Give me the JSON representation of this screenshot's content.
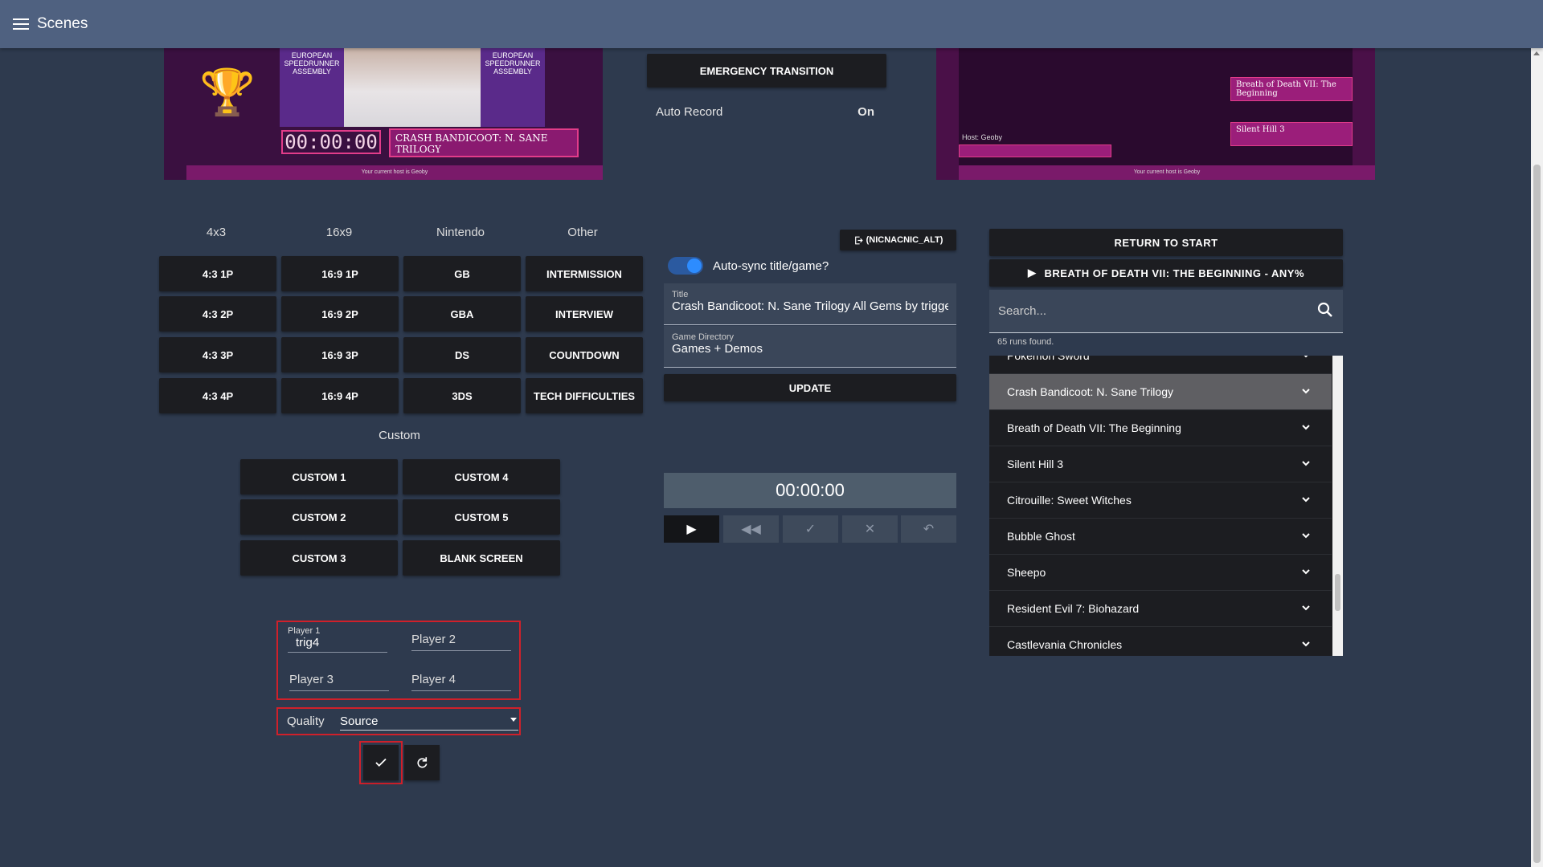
{
  "appbar": {
    "title": "Scenes"
  },
  "previews": {
    "left": {
      "banner1": "EUROPEAN SPEEDRUNNER ASSEMBLY",
      "banner2": "EUROPEAN SPEEDRUNNER ASSEMBLY",
      "timer": "00:00:00",
      "game": "CRASH BANDICOOT: N. SANE TRILOGY",
      "footer": "Your current host is Geoby"
    },
    "right": {
      "item1": "Breath of Death VII: The Beginning",
      "item2": "Silent Hill 3",
      "host": "Host: Geoby",
      "footer": "Your current host is Geoby"
    }
  },
  "center_top": {
    "emergency_label": "EMERGENCY TRANSITION",
    "auto_record_label": "Auto Record",
    "auto_record_value": "On"
  },
  "scenes": {
    "columns": [
      "4x3",
      "16x9",
      "Nintendo",
      "Other"
    ],
    "col_4x3": [
      "4:3 1P",
      "4:3 2P",
      "4:3 3P",
      "4:3 4P"
    ],
    "col_16x9": [
      "16:9 1P",
      "16:9 2P",
      "16:9 3P",
      "16:9 4P"
    ],
    "col_nintendo": [
      "GB",
      "GBA",
      "DS",
      "3DS"
    ],
    "col_other": [
      "INTERMISSION",
      "INTERVIEW",
      "COUNTDOWN",
      "TECH DIFFICULTIES"
    ],
    "custom_heading": "Custom",
    "custom": [
      "CUSTOM 1",
      "CUSTOM 2",
      "CUSTOM 3",
      "CUSTOM 4",
      "CUSTOM 5",
      "BLANK SCREEN"
    ]
  },
  "players": {
    "p1_label": "Player 1",
    "p1_value": "trig4",
    "p2_placeholder": "Player 2",
    "p3_placeholder": "Player 3",
    "p4_placeholder": "Player 4",
    "quality_label": "Quality",
    "quality_value": "Source"
  },
  "middle": {
    "account_chip": "(NICNACNIC_ALT)",
    "autosync_label": "Auto-sync title/game?",
    "autosync_on": true,
    "title_label": "Title",
    "title_value": "Crash Bandicoot: N. Sane Trilogy All Gems by trigge",
    "dir_label": "Game Directory",
    "dir_value": "Games + Demos",
    "update_label": "UPDATE",
    "timer": "00:00:00"
  },
  "right": {
    "return_label": "RETURN TO START",
    "current_run": "BREATH OF DEATH VII: THE BEGINNING - ANY%",
    "search_placeholder": "Search...",
    "runs_found": "65 runs found.",
    "runs": [
      "Pokemon Sword",
      "Crash Bandicoot: N. Sane Trilogy",
      "Breath of Death VII: The Beginning",
      "Silent Hill 3",
      "Citrouille: Sweet Witches",
      "Bubble Ghost",
      "Sheepo",
      "Resident Evil 7: Biohazard",
      "Castlevania Chronicles"
    ],
    "selected_index": 1
  },
  "colors": {
    "appbar": "#4f6180",
    "background": "#2e3a4e",
    "button": "#1c1d21",
    "highlight_red": "#d0202a",
    "toggle_accent": "#2d8cff"
  }
}
